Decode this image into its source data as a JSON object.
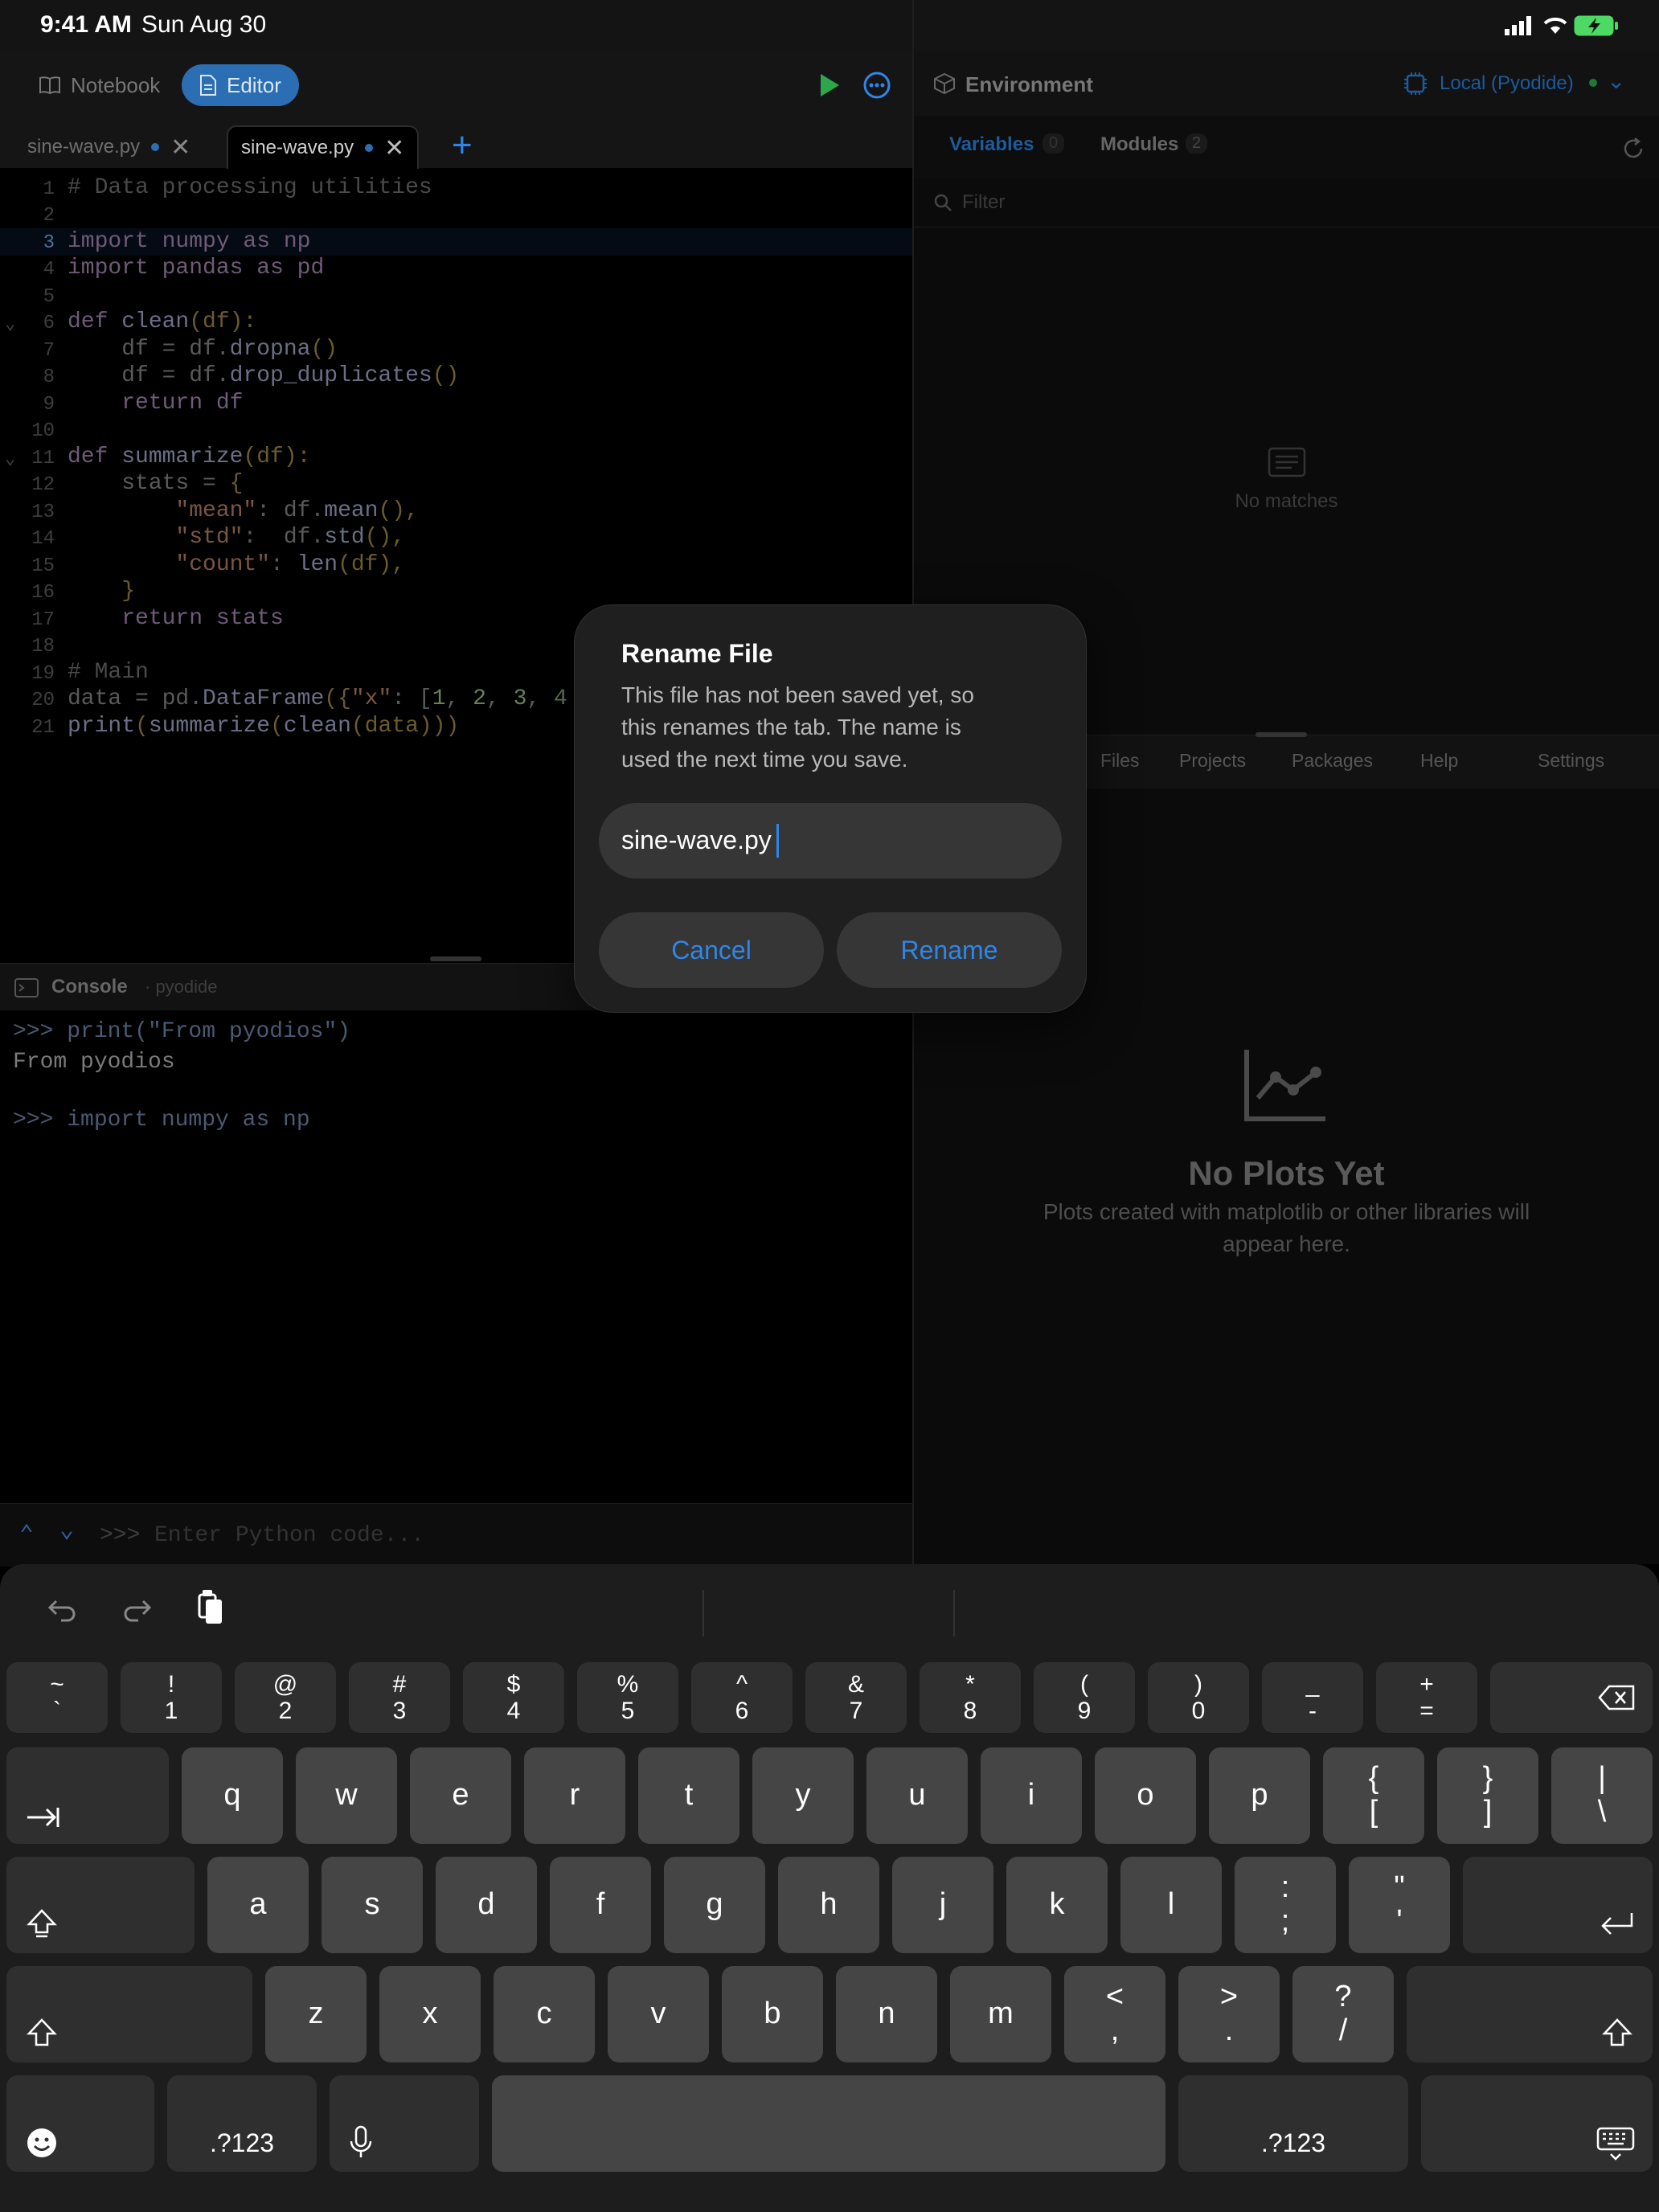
{
  "status_bar": {
    "time": "9:41 AM",
    "date": "Sun Aug 30"
  },
  "toolbar": {
    "notebook_label": "Notebook",
    "editor_label": "Editor"
  },
  "tabs": [
    {
      "label": "sine-wave.py"
    },
    {
      "label": "sine-wave.py"
    }
  ],
  "code_lines": [
    {
      "n": "1"
    },
    {
      "n": "2"
    },
    {
      "n": "3"
    },
    {
      "n": "4"
    },
    {
      "n": "5"
    },
    {
      "n": "6"
    },
    {
      "n": "7"
    },
    {
      "n": "8"
    },
    {
      "n": "9"
    },
    {
      "n": "10"
    },
    {
      "n": "11"
    },
    {
      "n": "12"
    },
    {
      "n": "13"
    },
    {
      "n": "14"
    },
    {
      "n": "15"
    },
    {
      "n": "16"
    },
    {
      "n": "17"
    },
    {
      "n": "18"
    },
    {
      "n": "19"
    },
    {
      "n": "20"
    },
    {
      "n": "21"
    }
  ],
  "code": {
    "l1": "# Data processing utilities",
    "l3": "import numpy as np",
    "l4": "import pandas as pd",
    "l6a": "def ",
    "l6b": "clean",
    "l6c": "(df):",
    "l7a": "    df = df.",
    "l7b": "dropna",
    "l7c": "()",
    "l8a": "    df = df.",
    "l8b": "drop_duplicates",
    "l8c": "()",
    "l9": "    return df",
    "l11a": "def ",
    "l11b": "summarize",
    "l11c": "(df):",
    "l12a": "    stats = ",
    "l12b": "{",
    "l13a": "        ",
    "l13b": "\"mean\"",
    "l13c": ": df.",
    "l13d": "mean",
    "l13e": "(),",
    "l14a": "        ",
    "l14b": "\"std\"",
    "l14c": ":  df.",
    "l14d": "std",
    "l14e": "(),",
    "l15a": "        ",
    "l15b": "\"count\"",
    "l15c": ": ",
    "l15d": "len",
    "l15e": "(df),",
    "l16": "    }",
    "l17": "    return stats",
    "l19": "# Main",
    "l20a": "data = pd.",
    "l20b": "DataFrame",
    "l20c": "({",
    "l20d": "\"x\"",
    "l20e": ": [",
    "l20f": "1",
    ", ": ", ",
    "l20g": "2",
    "l20h": "3",
    "l20i": "4",
    "l21a": "print",
    "l21b": "(",
    "l21c": "summarize",
    "l21d": "(",
    "l21e": "clean",
    "l21f": "(data)))"
  },
  "console": {
    "title": "Console",
    "subtitle": "· pyodide",
    "line1": ">>> print(\"From pyodios\")",
    "line2": "From pyodios",
    "line3": ">>> import numpy as np",
    "input_prompt": ">>>",
    "input_placeholder": "Enter Python code..."
  },
  "right_panel": {
    "environment_label": "Environment",
    "runtime_label": "Local (Pyodide)",
    "tab_variables": "Variables",
    "variables_count": "0",
    "tab_modules": "Modules",
    "modules_count": "2",
    "filter_placeholder": "Filter",
    "empty_label": "No matches",
    "bottom_tabs": [
      "Files",
      "Projects",
      "Packages",
      "Help",
      "Settings"
    ],
    "plots_title": "No Plots Yet",
    "plots_desc_line1": "Plots created with matplotlib or other libraries will",
    "plots_desc_line2": "appear here."
  },
  "dialog": {
    "title": "Rename File",
    "message_line1": "This file has not been saved yet, so",
    "message_line2": "this renames the tab. The name is",
    "message_line3": "used the next time you save.",
    "input_value": "sine-wave.py",
    "cancel_label": "Cancel",
    "rename_label": "Rename"
  },
  "keyboard": {
    "row1": [
      [
        "~",
        "`"
      ],
      [
        "!",
        "1"
      ],
      [
        "@",
        "2"
      ],
      [
        "#",
        "3"
      ],
      [
        "$",
        "4"
      ],
      [
        "%",
        "5"
      ],
      [
        "^",
        "6"
      ],
      [
        "&",
        "7"
      ],
      [
        "*",
        "8"
      ],
      [
        "(",
        "9"
      ],
      [
        ")",
        "0"
      ],
      [
        "_",
        "-"
      ],
      [
        "+",
        "="
      ]
    ],
    "row2": [
      "q",
      "w",
      "e",
      "r",
      "t",
      "y",
      "u",
      "i",
      "o",
      "p"
    ],
    "row2b": [
      [
        "{",
        "["
      ],
      [
        "}",
        "]"
      ],
      [
        "|",
        "\\"
      ]
    ],
    "row3": [
      "a",
      "s",
      "d",
      "f",
      "g",
      "h",
      "j",
      "k",
      "l"
    ],
    "row3b": [
      [
        ":",
        ";"
      ],
      [
        "\"",
        "'"
      ]
    ],
    "row4": [
      "z",
      "x",
      "c",
      "v",
      "b",
      "n",
      "m"
    ],
    "row4b": [
      [
        "<",
        ","
      ],
      [
        ">",
        "."
      ],
      [
        "?",
        "/"
      ]
    ],
    "num_label": ".?123"
  },
  "colors": {
    "accent": "#2f86e8",
    "run_green": "#2aa84a",
    "bg": "#000000"
  }
}
